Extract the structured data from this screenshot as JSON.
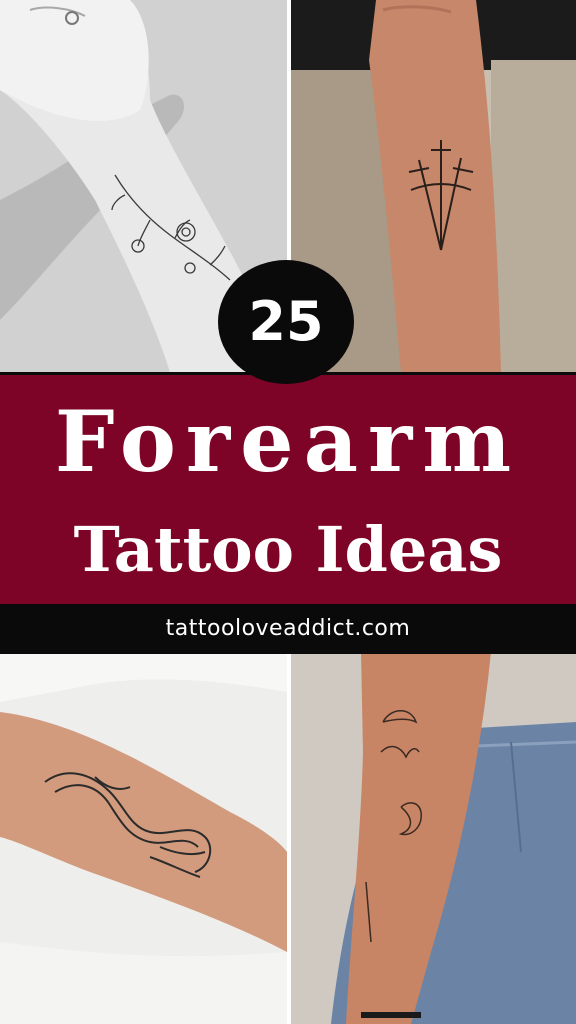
{
  "badge": {
    "number": "25"
  },
  "banner": {
    "title_line_1": "Forearm",
    "title_line_2": "Tattoo Ideas"
  },
  "footer": {
    "url": "tattooloveaddict.com"
  },
  "colors": {
    "banner_background": "#7d0426",
    "url_bar_background": "#0a0a0a",
    "badge_background": "#0a0a0a",
    "text": "#ffffff"
  },
  "photos": [
    {
      "id": "floral-forearm-tattoo-photo",
      "tattoo": "fine-line flowers, black and white"
    },
    {
      "id": "three-swords-forearm-tattoo-photo",
      "tattoo": "three swords"
    },
    {
      "id": "snake-hands-forearm-tattoo-photo",
      "tattoo": "snake held by two hands"
    },
    {
      "id": "lucky-moon-forearm-tattoo-photo",
      "tattoo": "script and crescent moon"
    }
  ]
}
